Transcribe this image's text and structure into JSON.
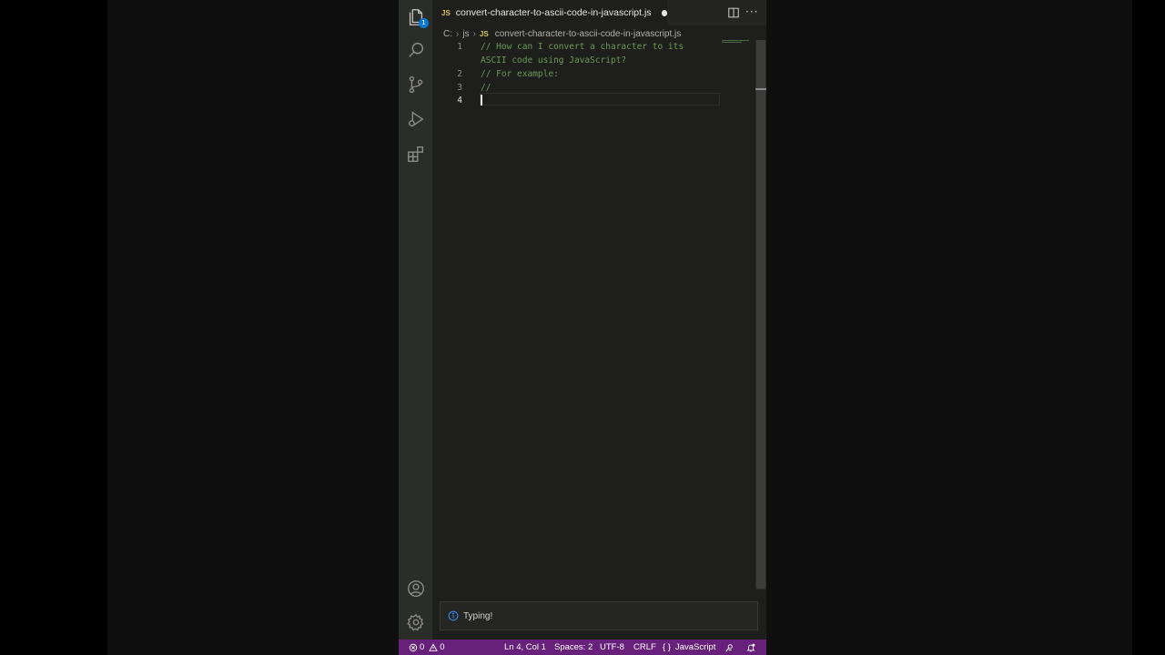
{
  "tab": {
    "lang_badge": "JS",
    "title": "convert-character-to-ascii-code-in-javascript.js"
  },
  "breadcrumb": {
    "drive": "C:",
    "folder": "js",
    "lang_badge": "JS",
    "file": "convert-character-to-ascii-code-in-javascript.js"
  },
  "editor": {
    "lines": [
      {
        "number": "1",
        "text": "// How can I convert a character to its"
      },
      {
        "number": "",
        "text": "ASCII code using JavaScript?"
      },
      {
        "number": "2",
        "text": "// For example:"
      },
      {
        "number": "3",
        "text": "//"
      },
      {
        "number": "4",
        "text": ""
      }
    ]
  },
  "activity_bar": {
    "explorer_badge": "1",
    "icons": [
      "files-icon",
      "search-icon",
      "source-control-icon",
      "run-debug-icon",
      "extensions-icon",
      "account-icon",
      "settings-gear-icon"
    ]
  },
  "notification": {
    "text": "Typing!"
  },
  "status_bar": {
    "errors": "0",
    "warnings": "0",
    "position": "Ln 4, Col 1",
    "spaces": "Spaces: 2",
    "encoding": "UTF-8",
    "eol": "CRLF",
    "language_prefix": "{ }",
    "language": "JavaScript"
  },
  "colors": {
    "status_bar": "#68217a",
    "comment": "#6a9955",
    "editor_bg": "#1e1f1c",
    "js_badge": "#d7c35a",
    "badge": "#0a78d6"
  }
}
